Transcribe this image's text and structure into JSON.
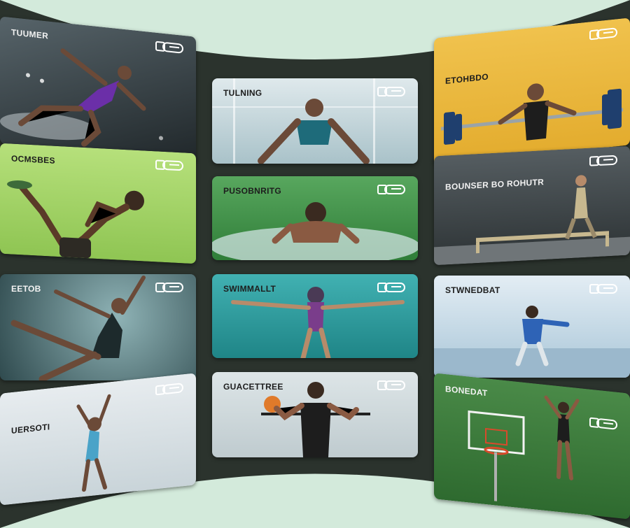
{
  "colors": {
    "page_bg": "#d3eadb",
    "wall": "#2b332d"
  },
  "cards": [
    {
      "id": "c1",
      "title": "TUUMER",
      "bg": "#3a4448",
      "accent": "#6b2fa8",
      "icon": "toggle-icon"
    },
    {
      "id": "c2",
      "title": "TULNING",
      "bg": "#b9cfd6",
      "accent": "#1e6b7a",
      "icon": "toggle-icon"
    },
    {
      "id": "c3",
      "title": "ETOHBDO",
      "bg": "#e9b840",
      "accent": "#1f3f6e",
      "icon": "toggle-icon"
    },
    {
      "id": "c4",
      "title": "OCMSBES",
      "bg": "#a7d66a",
      "accent": "#2d2a24",
      "icon": "toggle-icon"
    },
    {
      "id": "c5",
      "title": "PUSOBNRITG",
      "bg": "#3e8e46",
      "accent": "#2b8fb0",
      "icon": "toggle-icon"
    },
    {
      "id": "c6",
      "title": "BOUNSER BO ROHUTR",
      "bg": "#3d4346",
      "accent": "#c7b88f",
      "icon": "toggle-icon"
    },
    {
      "id": "c7",
      "title": "EETOB",
      "bg": "#3b5459",
      "accent": "#1d2a2c",
      "icon": "toggle-icon"
    },
    {
      "id": "c8",
      "title": "SWIMMALLT",
      "bg": "#2a9a9c",
      "accent": "#7a3d8b",
      "icon": "toggle-icon"
    },
    {
      "id": "c9",
      "title": "STWNEDBAT",
      "bg": "#c6dbe8",
      "accent": "#2e63b6",
      "icon": "toggle-icon"
    },
    {
      "id": "c10",
      "title": "UERSOTI",
      "bg": "#dbe3e6",
      "accent": "#4aa3c8",
      "icon": "toggle-icon"
    },
    {
      "id": "c11",
      "title": "GUACETTREE",
      "bg": "#cfd9dc",
      "accent": "#1d1d1d",
      "icon": "toggle-icon"
    },
    {
      "id": "c12",
      "title": "BONEDAT",
      "bg": "#3f7a3e",
      "accent": "#d84a2b",
      "icon": "toggle-icon"
    }
  ]
}
